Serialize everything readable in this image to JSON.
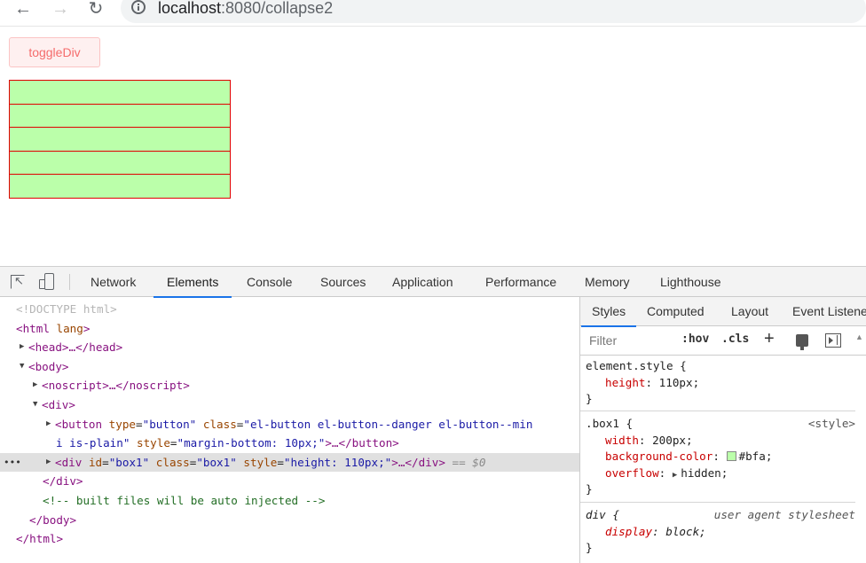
{
  "browser": {
    "url_host": "localhost",
    "url_path": ":8080/collapse2"
  },
  "page": {
    "toggle_button_label": "toggleDiv",
    "box_color": "#bfa",
    "box_border_color": "#e00000",
    "box_count": 5
  },
  "devtools": {
    "tabs": [
      "Network",
      "Elements",
      "Console",
      "Sources",
      "Application",
      "Performance",
      "Memory",
      "Lighthouse"
    ],
    "active_tab": "Elements",
    "tree": {
      "doctype": "<!DOCTYPE html>",
      "html_open_tag": "<html",
      "html_lang_attr": "lang",
      "html_open_close": ">",
      "head_line": "<head>…</head>",
      "body_open": "<body>",
      "noscript_line": "<noscript>…</noscript>",
      "div_open": "<div>",
      "button_line1_tag": "<button",
      "button_attr_type": "type",
      "button_val_type": "\"button\"",
      "button_attr_class": "class",
      "button_val_class_part1": "\"el-button el-button--danger el-button--min",
      "button_val_class_part2": "i is-plain\"",
      "button_attr_style": "style",
      "button_val_style": "\"margin-bottom: 10px;\"",
      "button_close": ">…</button>",
      "selected_div_tag": "<div",
      "selected_attr_id": "id",
      "selected_val_id": "\"box1\"",
      "selected_attr_class": "class",
      "selected_val_class": "\"box1\"",
      "selected_attr_style": "style",
      "selected_val_style": "\"height: 110px;\"",
      "selected_close": ">…</div>",
      "selected_marker": "== $0",
      "div_close": "</div>",
      "comment": "<!-- built files will be auto injected -->",
      "body_close": "</body>",
      "html_close": "</html>",
      "dots": "•••"
    },
    "styles": {
      "tabs": [
        "Styles",
        "Computed",
        "Layout",
        "Event Listene"
      ],
      "active_tab": "Styles",
      "filter_placeholder": "Filter",
      "hov_label": ":hov",
      "cls_label": ".cls",
      "plus_label": "+",
      "rules": {
        "element_style": {
          "selector": "element.style {",
          "prop_name": "height",
          "prop_value": "110px;",
          "close": "}"
        },
        "box1": {
          "selector": ".box1 {",
          "origin": "<style>",
          "width_name": "width",
          "width_value": "200px;",
          "bg_name": "background-color",
          "bg_value": "#bfa;",
          "bg_swatch": "#bbffaa",
          "overflow_name": "overflow",
          "overflow_value": "hidden;",
          "close": "}"
        },
        "div_ua": {
          "selector": "div {",
          "origin": "user agent stylesheet",
          "display_name": "display",
          "display_value": "block;",
          "close": "}"
        }
      }
    }
  }
}
